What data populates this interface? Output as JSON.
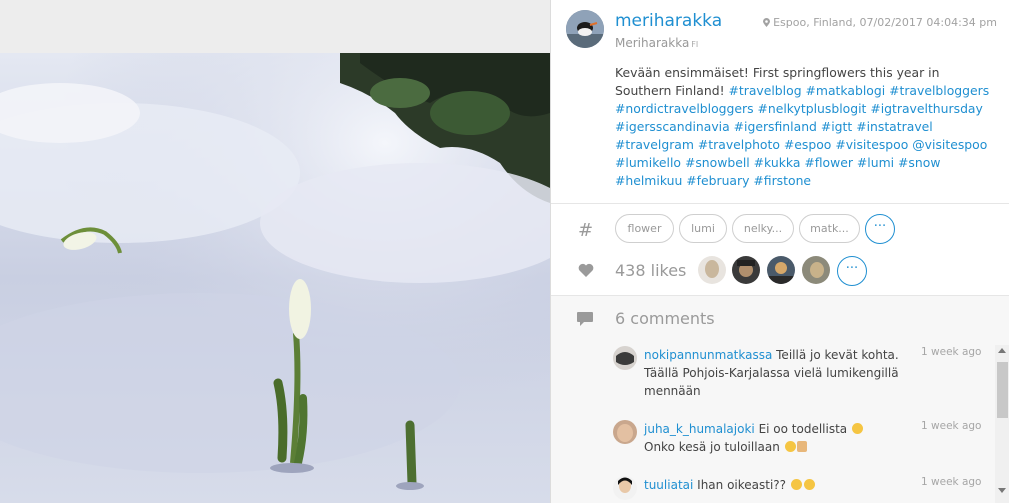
{
  "post": {
    "username": "meriharakka",
    "full_name": "Meriharakka",
    "country_code": "FI",
    "location_time": "Espoo, Finland, 07/02/2017 04:04:34 pm",
    "caption_text": "Kevään ensimmäiset! First springflowers this year in Southern Finland! ",
    "caption_tags": "#travelblog #matkablogi #travelbloggers #nordictravelbloggers #nelkytplusblogit #igtravelthursday #igersscandinavia #igersfinland #igtt #instatravel #travelgram #travelphoto #espoo #visitespoo @visitespoo #lumikello #snowbell #kukka #flower #lumi #snow #helmikuu #february #firstone"
  },
  "tags": {
    "icon": "#",
    "pills": [
      "flower",
      "lumi",
      "nelky...",
      "matk..."
    ],
    "more": "···"
  },
  "likes": {
    "label": "438 likes",
    "more": "···"
  },
  "comments": {
    "count_label": "6 comments",
    "items": [
      {
        "user": "nokipannunmatkassa",
        "text": " Teillä jo kevät kohta. Täällä Pohjois-Karjalassa vielä lumikengillä mennään",
        "time": "1 week ago"
      },
      {
        "user": "juha_k_humalajoki",
        "text": " Ei oo todellista ",
        "text2": " Onko kesä jo tuloillaan ",
        "time": "1 week ago"
      },
      {
        "user": "tuuliatai",
        "text": " Ihan oikeasti?? ",
        "time": "1 week ago"
      }
    ]
  },
  "icons": {
    "location": "map-pin-icon",
    "hashtag": "hashtag-icon",
    "likes": "heart-icon",
    "comments": "speech-bubble-icon"
  },
  "colors": {
    "accent": "#1f8fd1",
    "muted": "#9a9a9a",
    "text": "#444444"
  }
}
